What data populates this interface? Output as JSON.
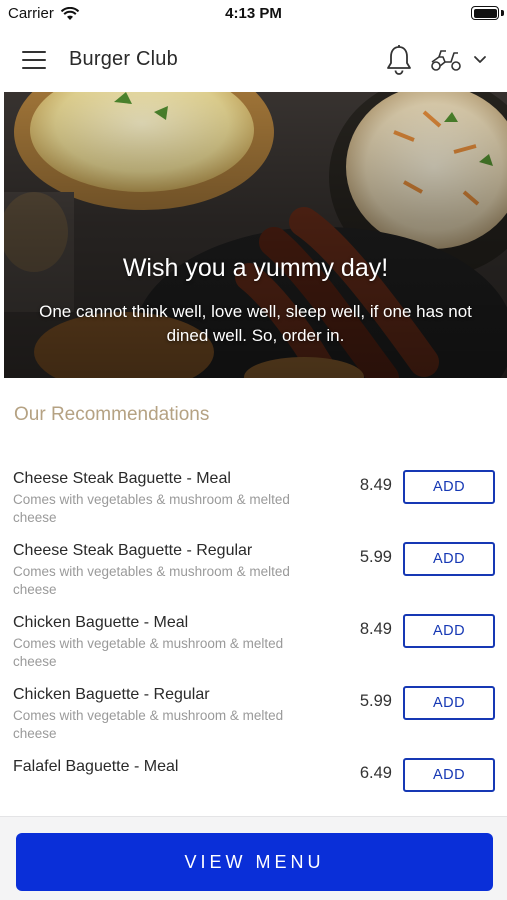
{
  "status_bar": {
    "carrier": "Carrier",
    "time": "4:13 PM"
  },
  "header": {
    "title": "Burger Club",
    "icons": [
      "hamburger-menu-icon",
      "bell-icon",
      "scooter-icon",
      "chevron-down-icon"
    ]
  },
  "hero": {
    "title": "Wish you a yummy day!",
    "subtitle": "One cannot think well, love well, sleep well, if one has not dined well. So, order in."
  },
  "recommendations": {
    "title": "Our Recommendations",
    "add_label": "ADD",
    "items": [
      {
        "name": "Cheese Steak Baguette - Meal",
        "description": "Comes with vegetables & mushroom & melted cheese",
        "price": "8.49"
      },
      {
        "name": "Cheese Steak Baguette - Regular",
        "description": "Comes with vegetables & mushroom & melted cheese",
        "price": "5.99"
      },
      {
        "name": "Chicken Baguette - Meal",
        "description": "Comes with vegetable & mushroom & melted cheese",
        "price": "8.49"
      },
      {
        "name": "Chicken Baguette - Regular",
        "description": "Comes with vegetable & mushroom & melted cheese",
        "price": "5.99"
      },
      {
        "name": "Falafel Baguette - Meal",
        "description": "",
        "price": "6.49"
      }
    ]
  },
  "footer": {
    "view_menu_label": "VIEW MENU"
  },
  "colors": {
    "primary_blue": "#0a2fd8",
    "add_button_blue": "#1638b4",
    "section_title_gold": "#b5a283"
  }
}
